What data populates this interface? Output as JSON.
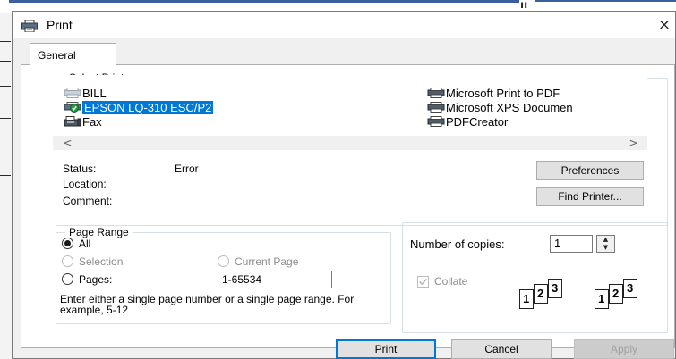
{
  "window": {
    "title": "Print",
    "close_glyph": "×",
    "title_icon": "printer-icon"
  },
  "tabs": [
    {
      "label": "General",
      "active": true
    }
  ],
  "select_printer": {
    "legend": "Select Printer",
    "printers": [
      {
        "name": "BILL",
        "icon": "printer-icon",
        "selected": false
      },
      {
        "name": "EPSON LQ-310 ESC/P2",
        "icon": "default-printer-icon",
        "selected": true
      },
      {
        "name": "Fax",
        "icon": "fax-icon",
        "selected": false
      },
      {
        "name": "Microsoft Print to PDF",
        "icon": "printer-icon",
        "selected": false
      },
      {
        "name": "Microsoft XPS Documen",
        "icon": "printer-icon",
        "selected": false
      },
      {
        "name": "PDFCreator",
        "icon": "printer-icon",
        "selected": false
      }
    ],
    "scroll_left": "<",
    "scroll_right": ">",
    "status_label": "Status:",
    "status_value": "Error",
    "location_label": "Location:",
    "location_value": "",
    "comment_label": "Comment:",
    "comment_value": "",
    "preferences_button": "Preferences",
    "find_printer_button": "Find Printer..."
  },
  "page_range": {
    "legend": "Page Range",
    "all_label": "All",
    "selection_label": "Selection",
    "current_page_label": "Current Page",
    "pages_label": "Pages:",
    "pages_value": "1-65534",
    "selected_option": "All",
    "hint": "Enter either a single page number or a single page range.  For example, 5-12"
  },
  "copies": {
    "label": "Number of copies:",
    "value": "1",
    "collate_label": "Collate",
    "collate_checked": true,
    "collate_enabled": false,
    "collated_pages": [
      "1",
      "2",
      "3"
    ],
    "uncollated_pages": [
      "1",
      "2",
      "3"
    ]
  },
  "buttons": {
    "print": "Print",
    "cancel": "Cancel",
    "apply": "Apply"
  },
  "colors": {
    "selection": "#0078d7",
    "dialog_bg": "#f0f0f0",
    "default_button_border": "#0078d7"
  }
}
